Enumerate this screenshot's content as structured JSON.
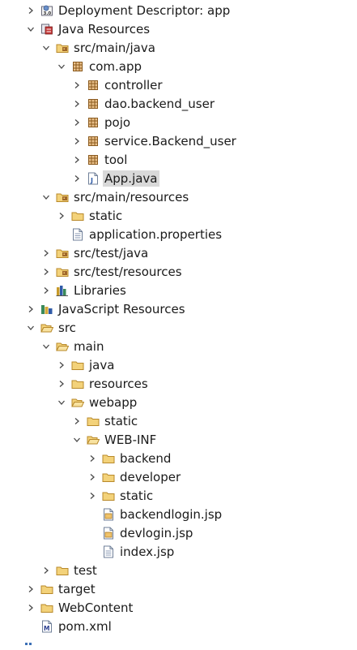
{
  "tree": {
    "rows": [
      {
        "label": "Deployment Descriptor: app",
        "arrow": "right",
        "icon": "deployment-descriptor-icon",
        "level": 0
      },
      {
        "label": "Java Resources",
        "arrow": "down",
        "icon": "java-resources-icon",
        "level": 0
      },
      {
        "label": "src/main/java",
        "arrow": "down",
        "icon": "source-folder-icon",
        "level": 1
      },
      {
        "label": "com.app",
        "arrow": "down",
        "icon": "package-icon",
        "level": 2
      },
      {
        "label": "controller",
        "arrow": "right",
        "icon": "package-icon",
        "level": 3
      },
      {
        "label": "dao.backend_user",
        "arrow": "right",
        "icon": "package-icon",
        "level": 3
      },
      {
        "label": "pojo",
        "arrow": "right",
        "icon": "package-icon",
        "level": 3
      },
      {
        "label": "service.Backend_user",
        "arrow": "right",
        "icon": "package-icon",
        "level": 3
      },
      {
        "label": "tool",
        "arrow": "right",
        "icon": "package-icon",
        "level": 3
      },
      {
        "label": "App.java",
        "arrow": "right",
        "icon": "java-file-icon",
        "level": 3,
        "selected": true
      },
      {
        "label": "src/main/resources",
        "arrow": "down",
        "icon": "source-folder-icon",
        "level": 1
      },
      {
        "label": "static",
        "arrow": "right",
        "icon": "folder-icon",
        "level": 2
      },
      {
        "label": "application.properties",
        "arrow": "none",
        "icon": "text-file-icon",
        "level": 2
      },
      {
        "label": "src/test/java",
        "arrow": "right",
        "icon": "source-folder-icon",
        "level": 1
      },
      {
        "label": "src/test/resources",
        "arrow": "right",
        "icon": "source-folder-icon",
        "level": 1
      },
      {
        "label": "Libraries",
        "arrow": "right",
        "icon": "libraries-icon",
        "level": 1
      },
      {
        "label": "JavaScript Resources",
        "arrow": "right",
        "icon": "javascript-resources-icon",
        "level": 0
      },
      {
        "label": "src",
        "arrow": "down",
        "icon": "folder-open-icon",
        "level": 0
      },
      {
        "label": "main",
        "arrow": "down",
        "icon": "folder-open-icon",
        "level": 1
      },
      {
        "label": "java",
        "arrow": "right",
        "icon": "folder-icon",
        "level": 2
      },
      {
        "label": "resources",
        "arrow": "right",
        "icon": "folder-icon",
        "level": 2
      },
      {
        "label": "webapp",
        "arrow": "down",
        "icon": "folder-open-icon",
        "level": 2
      },
      {
        "label": "static",
        "arrow": "right",
        "icon": "folder-icon",
        "level": 3
      },
      {
        "label": "WEB-INF",
        "arrow": "down",
        "icon": "folder-open-icon",
        "level": 3
      },
      {
        "label": "backend",
        "arrow": "right",
        "icon": "folder-icon",
        "level": 4
      },
      {
        "label": "developer",
        "arrow": "right",
        "icon": "folder-icon",
        "level": 4
      },
      {
        "label": "static",
        "arrow": "right",
        "icon": "folder-icon",
        "level": 4
      },
      {
        "label": "backendlogin.jsp",
        "arrow": "none",
        "icon": "jsp-file-icon",
        "level": 4
      },
      {
        "label": "devlogin.jsp",
        "arrow": "none",
        "icon": "jsp-file-icon",
        "level": 4
      },
      {
        "label": "index.jsp",
        "arrow": "none",
        "icon": "text-file-icon",
        "level": 4
      },
      {
        "label": "test",
        "arrow": "right",
        "icon": "folder-icon",
        "level": 1
      },
      {
        "label": "target",
        "arrow": "right",
        "icon": "folder-icon",
        "level": 0
      },
      {
        "label": "WebContent",
        "arrow": "right",
        "icon": "folder-icon",
        "level": 0
      },
      {
        "label": "pom.xml",
        "arrow": "none",
        "icon": "maven-file-icon",
        "level": 0
      }
    ]
  },
  "colors": {
    "folder": "#e8b84a",
    "package": "#b5792e",
    "selection": "#d9d9d9",
    "arrow": "#444444"
  }
}
